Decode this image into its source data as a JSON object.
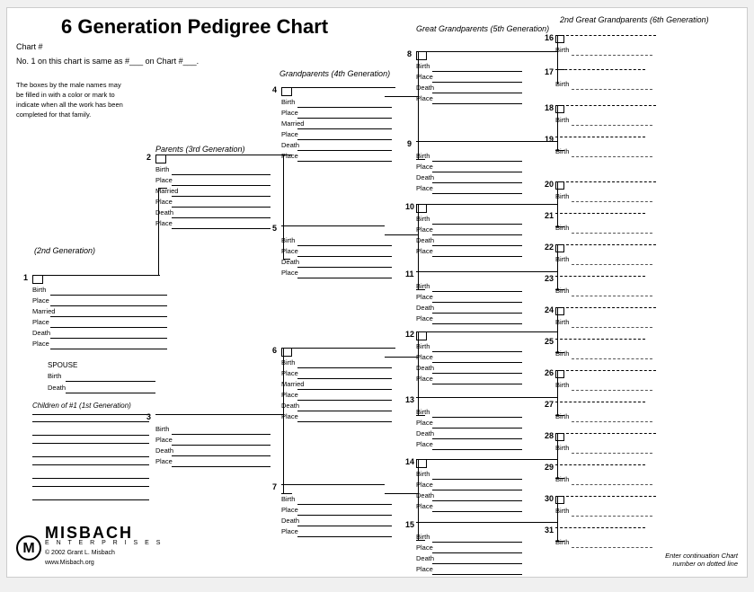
{
  "title": "6 Generation Pedigree Chart",
  "chartNum": "Chart #",
  "sameAs": "No. 1 on this chart is same\nas #___ on Chart #___.",
  "note": "The boxes by the male names may be filled in with a color or mark to indicate when all the work has been completed for that family.",
  "genLabels": {
    "gen2": "(2nd Generation)",
    "gen3": "Parents (3rd Generation)",
    "gen4": "Grandparents (4th Generation)",
    "gen5": "Great Grandparents (5th Generation)",
    "gen6": "2nd Great Grandparents (6th Generation)"
  },
  "fields": {
    "birth": "Birth",
    "place": "Place",
    "married": "Married",
    "death": "Death",
    "deathAlt": "Death"
  },
  "persons": [
    {
      "num": "1",
      "fields": [
        "Birth",
        "Place",
        "Married",
        "Place",
        "Death",
        "Place"
      ]
    },
    {
      "num": "2",
      "fields": [
        "Birth",
        "Place",
        "Married",
        "Place",
        "Death",
        "Place"
      ]
    },
    {
      "num": "3",
      "fields": [
        "Birth",
        "Place",
        "Death",
        "Place"
      ]
    },
    {
      "num": "4",
      "fields": [
        "Birth",
        "Place",
        "Married",
        "Place",
        "Death",
        "Place"
      ]
    },
    {
      "num": "5",
      "fields": [
        "Birth",
        "Place",
        "Death",
        "Place"
      ]
    },
    {
      "num": "6",
      "fields": [
        "Birth",
        "Place",
        "Married",
        "Place",
        "Death",
        "Place"
      ]
    },
    {
      "num": "7",
      "fields": [
        "Birth",
        "Place",
        "Death",
        "Place"
      ]
    },
    {
      "num": "8",
      "fields": [
        "Birth",
        "Place",
        "Death",
        "Place"
      ]
    },
    {
      "num": "9",
      "fields": [
        "Birth",
        "Place",
        "Death",
        "Place"
      ]
    },
    {
      "num": "10",
      "fields": [
        "Birth",
        "Place",
        "Death",
        "Place"
      ]
    },
    {
      "num": "11",
      "fields": [
        "Birth",
        "Place",
        "Death",
        "Place"
      ]
    },
    {
      "num": "12",
      "fields": [
        "Birth",
        "Place",
        "Death",
        "Place"
      ]
    },
    {
      "num": "13",
      "fields": [
        "Birth",
        "Place",
        "Death",
        "Place"
      ]
    },
    {
      "num": "14",
      "fields": [
        "Birth",
        "Place",
        "Death",
        "Place"
      ]
    },
    {
      "num": "15",
      "fields": [
        "Birth",
        "Place",
        "Death",
        "Place"
      ]
    }
  ],
  "spouse": {
    "label": "SPOUSE",
    "fields": [
      "Birth",
      "Death"
    ]
  },
  "children": {
    "label": "Children of #1 (1st Generation)"
  },
  "enterContinuation": "Enter continuation Chart\nnumber on dotted line",
  "logo": {
    "company": "MISBACH",
    "enterprises": "E N T E R P R I S E S",
    "copyright": "© 2002 Grant L. Misbach",
    "website": "www.Misbach.org"
  }
}
